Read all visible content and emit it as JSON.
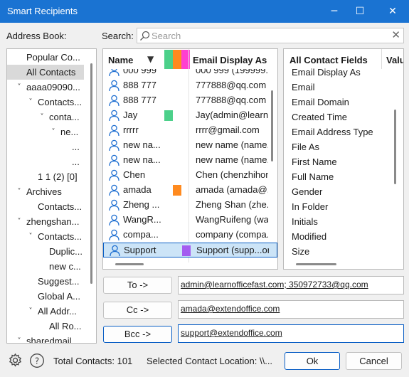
{
  "window": {
    "title": "Smart Recipients",
    "minimize": "─",
    "maximize": "☐",
    "close": "✕"
  },
  "address_book": {
    "label": "Address Book:"
  },
  "search": {
    "label": "Search:",
    "placeholder": "Search"
  },
  "tree": [
    {
      "label": "Popular Co...",
      "level": 0,
      "chev": "",
      "indent": 27
    },
    {
      "label": "All Contacts",
      "level": 0,
      "chev": "",
      "indent": 27,
      "selected": true
    },
    {
      "label": "aaaa09090...",
      "level": 0,
      "chev": "˅",
      "indent": 27
    },
    {
      "label": "Contacts...",
      "level": 1,
      "chev": "˅",
      "indent": 43
    },
    {
      "label": "conta...",
      "level": 2,
      "chev": "˅",
      "indent": 59
    },
    {
      "label": "ne...",
      "level": 3,
      "chev": "˅",
      "indent": 75
    },
    {
      "label": "...",
      "level": 4,
      "chev": "",
      "indent": 91
    },
    {
      "label": "...",
      "level": 4,
      "chev": "",
      "indent": 91
    },
    {
      "label": "1 1 (2) [0]",
      "level": 2,
      "chev": "",
      "indent": 43
    },
    {
      "label": "Archives",
      "level": 0,
      "chev": "˅",
      "indent": 27
    },
    {
      "label": "Contacts...",
      "level": 1,
      "chev": "",
      "indent": 43
    },
    {
      "label": "zhengshan...",
      "level": 0,
      "chev": "˅",
      "indent": 27
    },
    {
      "label": "Contacts...",
      "level": 1,
      "chev": "˅",
      "indent": 43
    },
    {
      "label": "Duplic...",
      "level": 2,
      "chev": "",
      "indent": 59
    },
    {
      "label": "new c...",
      "level": 2,
      "chev": "",
      "indent": 59
    },
    {
      "label": "Suggest...",
      "level": 1,
      "chev": "",
      "indent": 43
    },
    {
      "label": "Global A...",
      "level": 1,
      "chev": "",
      "indent": 43
    },
    {
      "label": "All Addr...",
      "level": 1,
      "chev": "˅",
      "indent": 43
    },
    {
      "label": "All Ro...",
      "level": 2,
      "chev": "",
      "indent": 59
    },
    {
      "label": "sharedmail...",
      "level": 0,
      "chev": "˅",
      "indent": 27
    }
  ],
  "grid": {
    "col_name": "Name",
    "col_email": "Email Display As",
    "header_colors": [
      "#4cd08a",
      "#ff8a1f",
      "#ff3fd0"
    ],
    "rows": [
      {
        "name": "000 999",
        "email": "000 999 (199999..."
      },
      {
        "name": "888 777",
        "email": "777888@qq.com"
      },
      {
        "name": "888 777",
        "email": "777888@qq.com"
      },
      {
        "name": "Jay",
        "email": "Jay(admin@learn...",
        "color": "#4cd08a",
        "color_col": 0
      },
      {
        "name": "rrrrr",
        "email": "rrrr@gmail.com"
      },
      {
        "name": "new na...",
        "email": "new name (name..."
      },
      {
        "name": "new na...",
        "email": "new name (name..."
      },
      {
        "name": "Chen",
        "email": "Chen (chenzhihon..."
      },
      {
        "name": "amada",
        "email": "amada (amada@...",
        "color": "#ff8a1f",
        "color_col": 1
      },
      {
        "name": "Zheng ...",
        "email": "Zheng Shan (zhe..."
      },
      {
        "name": "WangR...",
        "email": "WangRuifeng (wa..."
      },
      {
        "name": "compa...",
        "email": "company (compa..."
      },
      {
        "name": "Support",
        "email": "Support (supp...or...",
        "color": "#a45cf0",
        "color_col": 2,
        "selected": true
      }
    ]
  },
  "fields": {
    "header": "All Contact Fields",
    "header2": "Valu",
    "items": [
      "Email Display As",
      "Email",
      "Email Domain",
      "Created Time",
      "Email Address Type",
      "File As",
      "First Name",
      "Full Name",
      "Gender",
      "In Folder",
      "Initials",
      "Modified",
      "Size"
    ]
  },
  "recipients": {
    "to_label": "To ->",
    "to_value": "admin@learnofficefast.com; 350972733@qq.com",
    "cc_label": "Cc ->",
    "cc_value": "amada@extendoffice.com",
    "bcc_label": "Bcc ->",
    "bcc_value": "support@extendoffice.com"
  },
  "status": {
    "total": "Total Contacts: 101",
    "location": "Selected Contact Location: \\\\...",
    "ok": "Ok",
    "cancel": "Cancel"
  },
  "icons": {
    "settings": "gear-icon",
    "help": "help-icon",
    "search": "search-icon",
    "person": "person-icon"
  }
}
